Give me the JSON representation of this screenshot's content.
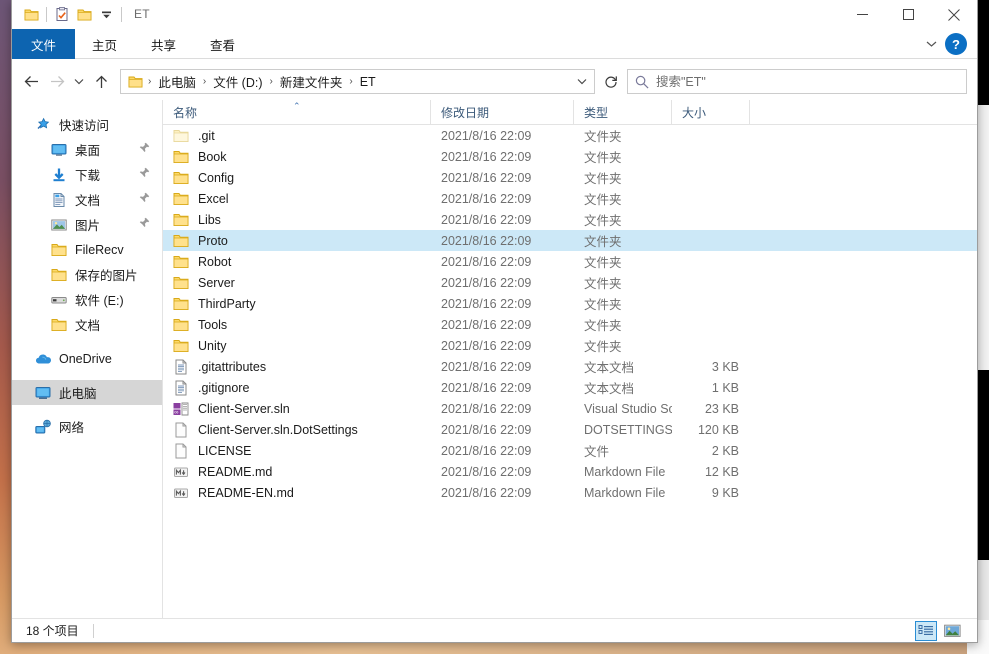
{
  "window": {
    "title": "ET",
    "quick_access_icons": [
      "folder-icon",
      "properties-icon",
      "new-folder-icon",
      "customize-dropdown-icon"
    ],
    "controls": {
      "minimize": "minimize-icon",
      "maximize": "maximize-icon",
      "close": "close-icon"
    }
  },
  "ribbon": {
    "tabs": [
      {
        "label": "文件",
        "name": "tab-file",
        "active": true
      },
      {
        "label": "主页",
        "name": "tab-home",
        "active": false
      },
      {
        "label": "共享",
        "name": "tab-share",
        "active": false
      },
      {
        "label": "查看",
        "name": "tab-view",
        "active": false
      }
    ],
    "expand_icon": "chevron-down-icon",
    "help_label": "?"
  },
  "address": {
    "back_icon": "arrow-left-icon",
    "forward_icon": "arrow-right-icon",
    "recent_icon": "chevron-down-icon",
    "up_icon": "arrow-up-icon",
    "folder_icon": "folder-icon",
    "crumbs": [
      "此电脑",
      "文件 (D:)",
      "新建文件夹",
      "ET"
    ],
    "separator": "›",
    "dropdown_icon": "chevron-down-icon",
    "refresh_icon": "refresh-icon"
  },
  "search": {
    "placeholder": "搜索\"ET\"",
    "value": "",
    "icon": "search-icon"
  },
  "sidebar": {
    "items": [
      {
        "label": "快速访问",
        "icon": "star-pin-icon",
        "level": "root",
        "pinned": false,
        "selected": false
      },
      {
        "label": "桌面",
        "icon": "desktop-icon",
        "level": "child",
        "pinned": true,
        "selected": false
      },
      {
        "label": "下载",
        "icon": "download-icon",
        "level": "child",
        "pinned": true,
        "selected": false
      },
      {
        "label": "文档",
        "icon": "documents-icon",
        "level": "child",
        "pinned": true,
        "selected": false
      },
      {
        "label": "图片",
        "icon": "pictures-icon",
        "level": "child",
        "pinned": true,
        "selected": false
      },
      {
        "label": "FileRecv",
        "icon": "folder-icon",
        "level": "child",
        "pinned": false,
        "selected": false
      },
      {
        "label": "保存的图片",
        "icon": "folder-icon",
        "level": "child",
        "pinned": false,
        "selected": false
      },
      {
        "label": "软件 (E:)",
        "icon": "drive-icon",
        "level": "child",
        "pinned": false,
        "selected": false
      },
      {
        "label": "文档",
        "icon": "folder-icon",
        "level": "child",
        "pinned": false,
        "selected": false
      },
      {
        "label": "OneDrive",
        "icon": "onedrive-cloud-icon",
        "level": "root",
        "pinned": false,
        "selected": false,
        "gap_before": true
      },
      {
        "label": "此电脑",
        "icon": "this-pc-icon",
        "level": "root",
        "pinned": false,
        "selected": true,
        "gap_before": true
      },
      {
        "label": "网络",
        "icon": "network-icon",
        "level": "root",
        "pinned": false,
        "selected": false,
        "gap_before": true
      }
    ]
  },
  "columns": {
    "name": "名称",
    "date": "修改日期",
    "type": "类型",
    "size": "大小",
    "sort_caret": "⌃",
    "sort_column": "名称",
    "sort_direction": "asc"
  },
  "files": [
    {
      "name": ".git",
      "date": "2021/8/16 22:09",
      "type": "文件夹",
      "size": "",
      "icon": "folder-hidden-icon",
      "selected": false
    },
    {
      "name": "Book",
      "date": "2021/8/16 22:09",
      "type": "文件夹",
      "size": "",
      "icon": "folder-icon",
      "selected": false
    },
    {
      "name": "Config",
      "date": "2021/8/16 22:09",
      "type": "文件夹",
      "size": "",
      "icon": "folder-icon",
      "selected": false
    },
    {
      "name": "Excel",
      "date": "2021/8/16 22:09",
      "type": "文件夹",
      "size": "",
      "icon": "folder-icon",
      "selected": false
    },
    {
      "name": "Libs",
      "date": "2021/8/16 22:09",
      "type": "文件夹",
      "size": "",
      "icon": "folder-icon",
      "selected": false
    },
    {
      "name": "Proto",
      "date": "2021/8/16 22:09",
      "type": "文件夹",
      "size": "",
      "icon": "folder-icon",
      "selected": true
    },
    {
      "name": "Robot",
      "date": "2021/8/16 22:09",
      "type": "文件夹",
      "size": "",
      "icon": "folder-icon",
      "selected": false
    },
    {
      "name": "Server",
      "date": "2021/8/16 22:09",
      "type": "文件夹",
      "size": "",
      "icon": "folder-icon",
      "selected": false
    },
    {
      "name": "ThirdParty",
      "date": "2021/8/16 22:09",
      "type": "文件夹",
      "size": "",
      "icon": "folder-icon",
      "selected": false
    },
    {
      "name": "Tools",
      "date": "2021/8/16 22:09",
      "type": "文件夹",
      "size": "",
      "icon": "folder-icon",
      "selected": false
    },
    {
      "name": "Unity",
      "date": "2021/8/16 22:09",
      "type": "文件夹",
      "size": "",
      "icon": "folder-icon",
      "selected": false
    },
    {
      "name": ".gitattributes",
      "date": "2021/8/16 22:09",
      "type": "文本文档",
      "size": "3 KB",
      "icon": "text-file-icon",
      "selected": false
    },
    {
      "name": ".gitignore",
      "date": "2021/8/16 22:09",
      "type": "文本文档",
      "size": "1 KB",
      "icon": "text-file-icon",
      "selected": false
    },
    {
      "name": "Client-Server.sln",
      "date": "2021/8/16 22:09",
      "type": "Visual Studio Sol...",
      "size": "23 KB",
      "icon": "visual-studio-icon",
      "selected": false
    },
    {
      "name": "Client-Server.sln.DotSettings",
      "date": "2021/8/16 22:09",
      "type": "DOTSETTINGS ...",
      "size": "120 KB",
      "icon": "blank-file-icon",
      "selected": false
    },
    {
      "name": "LICENSE",
      "date": "2021/8/16 22:09",
      "type": "文件",
      "size": "2 KB",
      "icon": "blank-file-icon",
      "selected": false
    },
    {
      "name": "README.md",
      "date": "2021/8/16 22:09",
      "type": "Markdown File",
      "size": "12 KB",
      "icon": "markdown-icon",
      "selected": false
    },
    {
      "name": "README-EN.md",
      "date": "2021/8/16 22:09",
      "type": "Markdown File",
      "size": "9 KB",
      "icon": "markdown-icon",
      "selected": false
    }
  ],
  "status": {
    "item_count_text": "18 个项目",
    "views": [
      {
        "name": "details-view-button",
        "icon": "details-view-icon",
        "active": true
      },
      {
        "name": "large-icons-view-button",
        "icon": "large-icons-view-icon",
        "active": false
      }
    ]
  },
  "colors": {
    "accent_blue": "#0d64b0",
    "selection_blue": "#cce8f7",
    "folder_yellow": "#ffd966",
    "help_blue": "#0b6fc4"
  }
}
